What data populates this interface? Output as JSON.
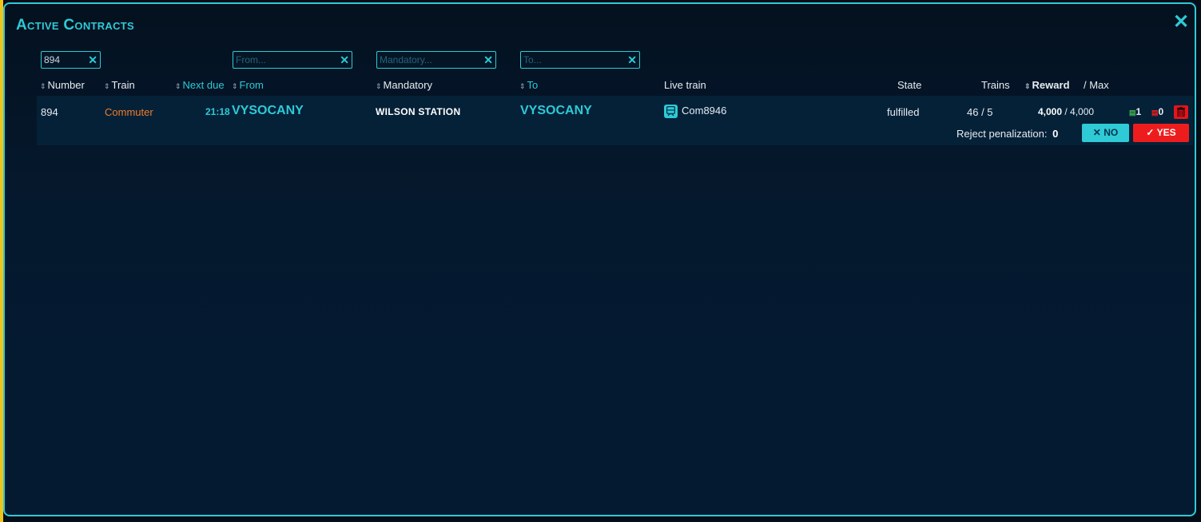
{
  "window": {
    "title": "Active Contracts",
    "close_icon": "close-icon"
  },
  "filters": {
    "number_value": "894",
    "from_placeholder": "From...",
    "mandatory_placeholder": "Mandatory...",
    "to_placeholder": "To...",
    "clear_symbol": "✕"
  },
  "columns": {
    "number": "Number",
    "train": "Train",
    "next_due": "Next due",
    "from": "From",
    "mandatory": "Mandatory",
    "to": "To",
    "live_train": "Live train",
    "state": "State",
    "trains": "Trains",
    "reward": "Reward",
    "max": "/ Max",
    "sort_icon": "⇕"
  },
  "rows": [
    {
      "number": "894",
      "train": "Commuter",
      "next_due": "21:18",
      "from": "VYSOCANY",
      "mandatory": "WILSON STATION",
      "to": "VYSOCANY",
      "live_train": "Com8946",
      "state": "fulfilled",
      "trains": "46 / 5",
      "reward": "4,000",
      "max": "/ 4,000",
      "passed_count": "1",
      "failed_count": "0",
      "reject_label": "Reject penalization:",
      "reject_value": "0",
      "no_label": "NO",
      "yes_label": "YES"
    }
  ],
  "colors": {
    "accent": "#2ecad6",
    "danger": "#ee1d1d",
    "train_type": "#f07a2a",
    "success": "#3fb34f"
  }
}
